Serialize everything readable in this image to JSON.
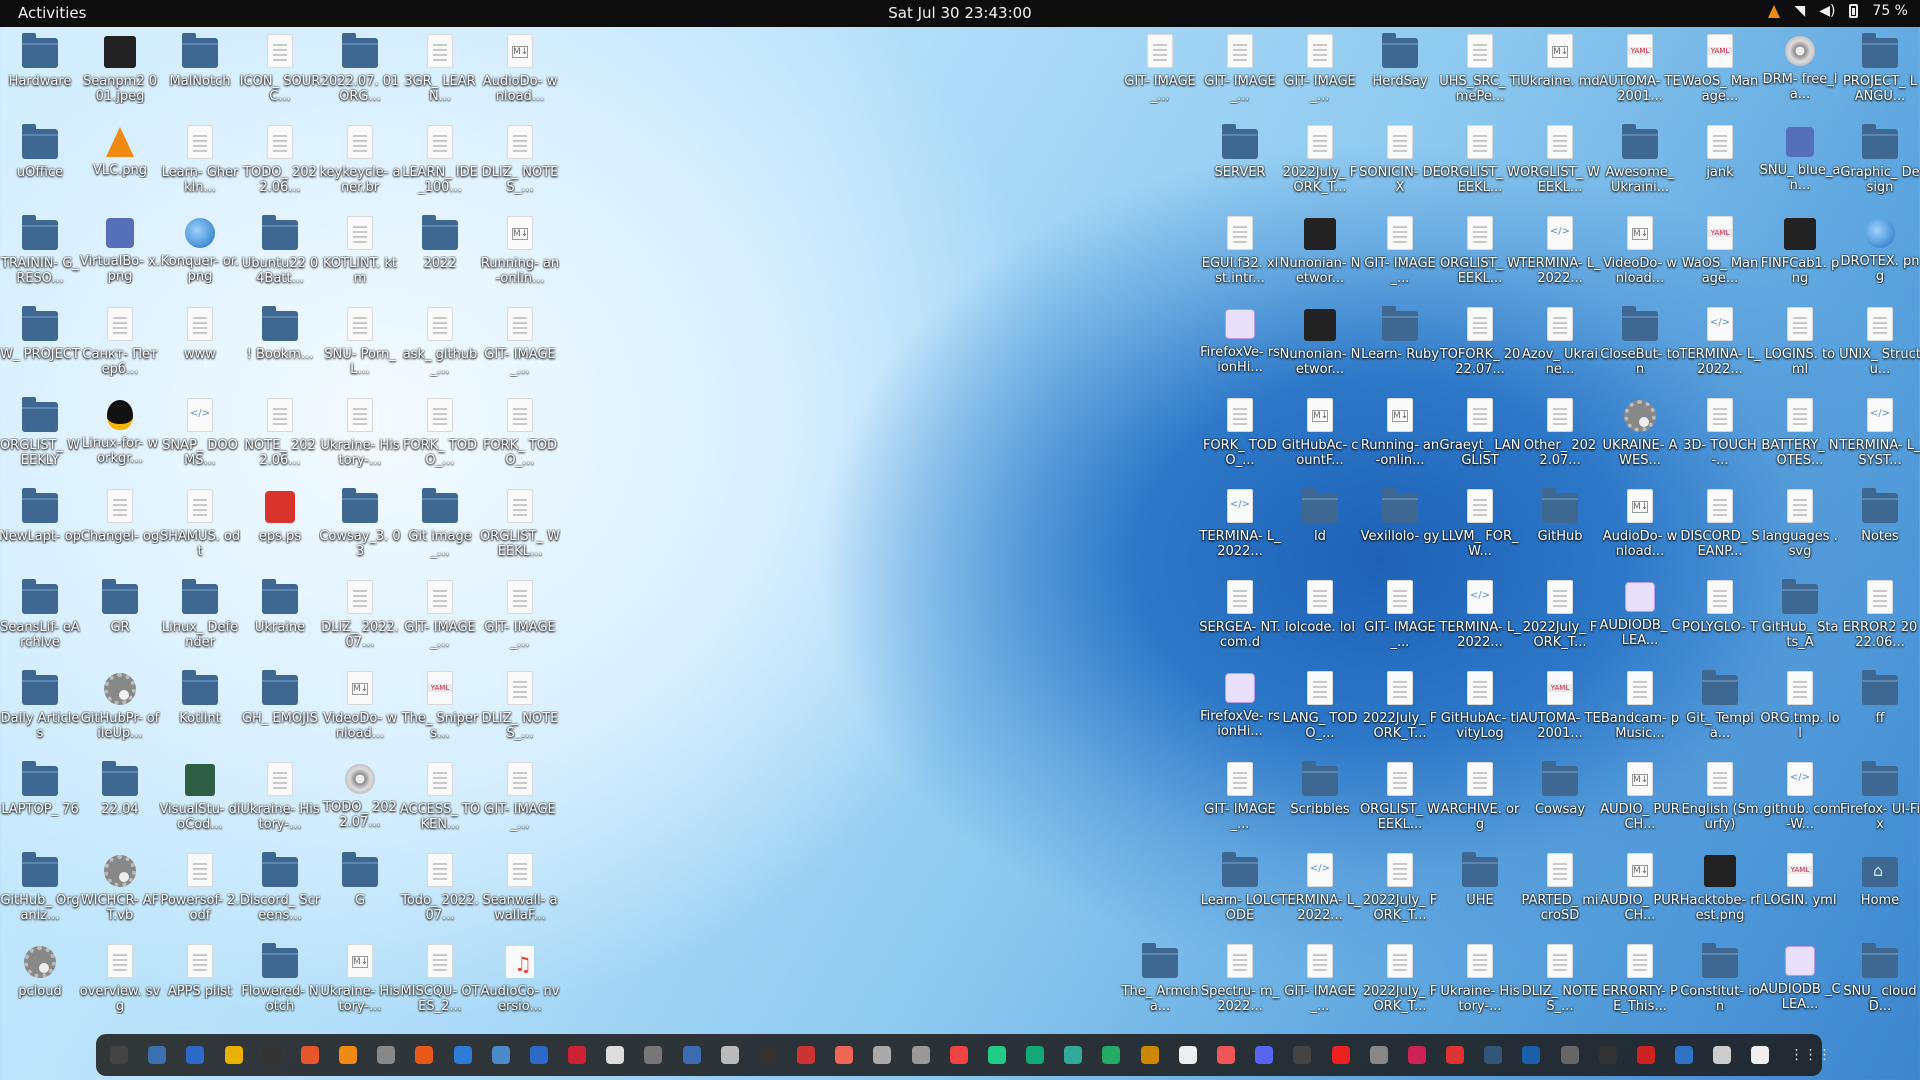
{
  "topbar": {
    "activities": "Activities",
    "clock": "Sat Jul 30  23:43:00",
    "battery": "75 %"
  },
  "desktop": {
    "icons": [
      {
        "label": "Hardware",
        "type": "folder"
      },
      {
        "label": "Seanpm2 001.jpeg",
        "type": "img"
      },
      {
        "label": "MalNotch",
        "type": "folder"
      },
      {
        "label": "ICON_ SOURC...",
        "type": "file"
      },
      {
        "label": "2022.07. 01ORG...",
        "type": "folder"
      },
      {
        "label": "3GR_ LEARN...",
        "type": "file"
      },
      {
        "label": "AudioDo- wnload...",
        "type": "md"
      },
      {
        "label": "uOffice",
        "type": "folder"
      },
      {
        "label": "VLC.png",
        "type": "cone"
      },
      {
        "label": "Learn- Gherkin...",
        "type": "file"
      },
      {
        "label": "TODO_ 2022.06...",
        "type": "file"
      },
      {
        "label": "keykeycle- aner.br",
        "type": "file"
      },
      {
        "label": "LEARN_ IDE_100...",
        "type": "file"
      },
      {
        "label": "DLIZ_ NOTES_...",
        "type": "file"
      },
      {
        "label": "TRAININ- G_RESO...",
        "type": "folder"
      },
      {
        "label": "VirtualBo- x.png",
        "type": "box"
      },
      {
        "label": "Konquer- or.png",
        "type": "globe"
      },
      {
        "label": "Ubuntu22 04Batt...",
        "type": "folder"
      },
      {
        "label": "KOTLINT. ktm",
        "type": "file"
      },
      {
        "label": "2022",
        "type": "folder"
      },
      {
        "label": "Running- an-onlin...",
        "type": "md"
      },
      {
        "label": "W_ PROJECT",
        "type": "folder"
      },
      {
        "label": "Санкт- Петерб...",
        "type": "file"
      },
      {
        "label": "www",
        "type": "file"
      },
      {
        "label": "! Bookm...",
        "type": "folder"
      },
      {
        "label": "SNU- Porn_L...",
        "type": "file"
      },
      {
        "label": "ask_ github_...",
        "type": "file"
      },
      {
        "label": "GIT- IMAGE_...",
        "type": "file"
      },
      {
        "label": "ORGLIST_ WEEKLY",
        "type": "folder"
      },
      {
        "label": "Linux-for- workgr...",
        "type": "penguin"
      },
      {
        "label": "SNAP_ DOOMS...",
        "type": "code"
      },
      {
        "label": "NOTE_ 2022.06...",
        "type": "file"
      },
      {
        "label": "Ukraine- History-...",
        "type": "file"
      },
      {
        "label": "FORK_ TODO_...",
        "type": "file"
      },
      {
        "label": "FORK_ TODO_...",
        "type": "file"
      },
      {
        "label": "NewLapt- op",
        "type": "folder"
      },
      {
        "label": "Changel- og",
        "type": "file"
      },
      {
        "label": "SHAMUS. odt",
        "type": "file"
      },
      {
        "label": "eps.ps",
        "type": "red"
      },
      {
        "label": "Cowsay_3. 03",
        "type": "folder"
      },
      {
        "label": "Git image_...",
        "type": "folder"
      },
      {
        "label": "ORGLIST_ WEEKL...",
        "type": "file"
      },
      {
        "label": "SeansLif- eArchive",
        "type": "folder"
      },
      {
        "label": "GR",
        "type": "folder"
      },
      {
        "label": "Linux_ Defender",
        "type": "folder"
      },
      {
        "label": "Ukraine",
        "type": "folder"
      },
      {
        "label": "DLIZ_ 2022.07...",
        "type": "file"
      },
      {
        "label": "GIT- IMAGE_...",
        "type": "file"
      },
      {
        "label": "GIT- IMAGE_...",
        "type": "file"
      },
      {
        "label": "Daily Articles",
        "type": "folder"
      },
      {
        "label": "GitHubPr- ofileUp...",
        "type": "gear"
      },
      {
        "label": "Kotlint",
        "type": "folder"
      },
      {
        "label": "GH_ EMOJIS",
        "type": "folder"
      },
      {
        "label": "VideoDo- wnload...",
        "type": "md"
      },
      {
        "label": "The_ Snipers...",
        "type": "yaml"
      },
      {
        "label": "DLIZ_ NOTES_...",
        "type": "file"
      },
      {
        "label": "LAPTOP_ 76",
        "type": "folder"
      },
      {
        "label": "22.04",
        "type": "folder"
      },
      {
        "label": "VisualStu- dioCod...",
        "type": "green"
      },
      {
        "label": "Ukraine- History-...",
        "type": "file"
      },
      {
        "label": "TODO_ 2022.07...",
        "type": "disc"
      },
      {
        "label": "ACCESS_ TOKEN...",
        "type": "file"
      },
      {
        "label": "GIT- IMAGE_...",
        "type": "file"
      },
      {
        "label": "GitHub_ Organiz...",
        "type": "folder"
      },
      {
        "label": "WICHCR- AFT.vb",
        "type": "gear"
      },
      {
        "label": "Powersof- 2.odf",
        "type": "file"
      },
      {
        "label": "Discord_ Screens...",
        "type": "folder"
      },
      {
        "label": "G",
        "type": "folder"
      },
      {
        "label": "Todo_ 2022.07...",
        "type": "file"
      },
      {
        "label": "Seanwall- awallaF...",
        "type": "file"
      },
      {
        "label": "pcloud",
        "type": "gear"
      },
      {
        "label": "overview. svg",
        "type": "file"
      },
      {
        "label": "APPS plist",
        "type": "file"
      },
      {
        "label": "Flowered- Notch",
        "type": "folder"
      },
      {
        "label": "Ukraine- History-...",
        "type": "md"
      },
      {
        "label": "MISCQU- OTES_2...",
        "type": "file"
      },
      {
        "label": "AudioCo- nversio...",
        "type": "music"
      }
    ],
    "right_icons": [
      [
        {
          "label": "GIT- IMAGE_...",
          "type": "file"
        },
        {
          "label": "GIT- IMAGE_...",
          "type": "file"
        },
        {
          "label": "GIT- IMAGE_...",
          "type": "file"
        },
        {
          "label": "HerdSay",
          "type": "folder"
        },
        {
          "label": "UHS_SRC_ TimePe...",
          "type": "file"
        },
        {
          "label": "Ukraine. md",
          "type": "md"
        },
        {
          "label": "AUTOMA- TE2001...",
          "type": "yaml"
        },
        {
          "label": "WaOS_ Manage...",
          "type": "yaml"
        },
        {
          "label": "DRM- free_la...",
          "type": "disc"
        },
        {
          "label": "PROJECT_ LANGU...",
          "type": "folder"
        }
      ],
      [
        {
          "label": "SERVER",
          "type": "folder"
        },
        {
          "label": "2022July_ FORK_T...",
          "type": "file"
        },
        {
          "label": "SONICIN- DEX",
          "type": "file"
        },
        {
          "label": "ORGLIST_ WEEKL...",
          "type": "file"
        },
        {
          "label": "ORGLIST_ WEEKL...",
          "type": "file"
        },
        {
          "label": "Awesome_ Ukraini...",
          "type": "folder"
        },
        {
          "label": "jank",
          "type": "file"
        },
        {
          "label": "SNU_ blue_an...",
          "type": "box"
        },
        {
          "label": "Graphic_ Design",
          "type": "folder"
        }
      ],
      [
        {
          "label": "EGUI.f32. xlst.intr...",
          "type": "file"
        },
        {
          "label": "Nunonian- Networ...",
          "type": "img"
        },
        {
          "label": "GIT- IMAGE_...",
          "type": "file"
        },
        {
          "label": "ORGLIST_ WEEKL...",
          "type": "file"
        },
        {
          "label": "TERMINA- L_2022...",
          "type": "code"
        },
        {
          "label": "VideoDo- wnload...",
          "type": "md"
        },
        {
          "label": "WaOS_ Manage...",
          "type": "yaml"
        },
        {
          "label": "FINFCab1. png",
          "type": "img"
        },
        {
          "label": "DROTEX. png",
          "type": "globe"
        }
      ],
      [
        {
          "label": "FirefoxVe- rsionHi...",
          "type": "purple"
        },
        {
          "label": "Nunonian- Networ...",
          "type": "img"
        },
        {
          "label": "Learn- Ruby",
          "type": "folder"
        },
        {
          "label": "TOFORK_ 2022.07...",
          "type": "file"
        },
        {
          "label": "Azov_ Ukraine...",
          "type": "file"
        },
        {
          "label": "CloseBut- ton",
          "type": "folder"
        },
        {
          "label": "TERMINA- L_2022...",
          "type": "code"
        },
        {
          "label": "LOGINS. toml",
          "type": "file"
        },
        {
          "label": "UNIX_ Structu...",
          "type": "file"
        }
      ],
      [
        {
          "label": "FORK_ TODO_...",
          "type": "file"
        },
        {
          "label": "GitHubAc- countF...",
          "type": "md"
        },
        {
          "label": "Running- an-onlin...",
          "type": "md"
        },
        {
          "label": "Graeyt_ LANGLIST",
          "type": "file"
        },
        {
          "label": "Other_ 2022.07...",
          "type": "file"
        },
        {
          "label": "UKRAINE- AWES...",
          "type": "gear"
        },
        {
          "label": "3D- TOUCH-...",
          "type": "file"
        },
        {
          "label": "BATTERY_ NOTES...",
          "type": "file"
        },
        {
          "label": "TERMINA- L_SYST...",
          "type": "code"
        }
      ],
      [
        {
          "label": "TERMINA- L_2022...",
          "type": "code"
        },
        {
          "label": "ld",
          "type": "folder"
        },
        {
          "label": "Vexillolo- gy",
          "type": "folder"
        },
        {
          "label": "LLVM_ FOR_W...",
          "type": "file"
        },
        {
          "label": "GitHub",
          "type": "folder"
        },
        {
          "label": "AudioDo- wnload...",
          "type": "md"
        },
        {
          "label": "DISCORD_ SEANP...",
          "type": "file"
        },
        {
          "label": "languages .svg",
          "type": "file"
        },
        {
          "label": "Notes",
          "type": "folder"
        }
      ],
      [
        {
          "label": "SERGEA- NT.com.d",
          "type": "file"
        },
        {
          "label": "lolcode. lol",
          "type": "file"
        },
        {
          "label": "GIT- IMAGE_...",
          "type": "file"
        },
        {
          "label": "TERMINA- L_2022...",
          "type": "code"
        },
        {
          "label": "2022July_ FORK_T...",
          "type": "file"
        },
        {
          "label": "AUDIODB_ CLEA...",
          "type": "purple"
        },
        {
          "label": "POLYGLO- T",
          "type": "file"
        },
        {
          "label": "GitHub_ Stats_A",
          "type": "folder"
        },
        {
          "label": "ERROR2 2022.06...",
          "type": "file"
        }
      ],
      [
        {
          "label": "FirefoxVe- rsionHi...",
          "type": "purple"
        },
        {
          "label": "LANG_ TODO_...",
          "type": "file"
        },
        {
          "label": "2022July_ FORK_T...",
          "type": "file"
        },
        {
          "label": "GitHubAc- tivityLog",
          "type": "file"
        },
        {
          "label": "AUTOMA- TE2001...",
          "type": "yaml"
        },
        {
          "label": "Bandcam- pMusic...",
          "type": "file"
        },
        {
          "label": "Git_ Templa...",
          "type": "folder"
        },
        {
          "label": "ORG.tmp. lol",
          "type": "file"
        },
        {
          "label": "ff",
          "type": "folder"
        }
      ],
      [
        {
          "label": "GIT- IMAGE_...",
          "type": "file"
        },
        {
          "label": "Scribbles",
          "type": "folder"
        },
        {
          "label": "ORGLIST_ WEEKL...",
          "type": "file"
        },
        {
          "label": "ARCHIVE. org",
          "type": "file"
        },
        {
          "label": "Cowsay",
          "type": "folder"
        },
        {
          "label": "AUDIO_ PURCH...",
          "type": "md"
        },
        {
          "label": "English (Smurfy)",
          "type": "file"
        },
        {
          "label": ".github. com-W...",
          "type": "code"
        },
        {
          "label": "Firefox- UI-Fix",
          "type": "folder"
        }
      ],
      [
        {
          "label": "Learn- LOLCODE",
          "type": "folder"
        },
        {
          "label": "TERMINA- L_2022...",
          "type": "code"
        },
        {
          "label": "2022July_ FORK_T...",
          "type": "file"
        },
        {
          "label": "UHE",
          "type": "folder"
        },
        {
          "label": "PARTED_ microSD",
          "type": "file"
        },
        {
          "label": "AUDIO_ PURCH...",
          "type": "md"
        },
        {
          "label": "Hacktobe- rfest.png",
          "type": "img"
        },
        {
          "label": "LOGIN. yml",
          "type": "yaml"
        },
        {
          "label": "Home",
          "type": "home"
        }
      ],
      [
        {
          "label": "The_ Armcha...",
          "type": "folder"
        },
        {
          "label": "Spectru- m_2022...",
          "type": "file"
        },
        {
          "label": "GIT- IMAGE_...",
          "type": "file"
        },
        {
          "label": "2022July_ FORK_T...",
          "type": "file"
        },
        {
          "label": "Ukraine- History-...",
          "type": "file"
        },
        {
          "label": "DLIZ_ NOTES_...",
          "type": "file"
        },
        {
          "label": "ERRORTY- PE_This...",
          "type": "file"
        },
        {
          "label": "Constitut- ion",
          "type": "folder"
        },
        {
          "label": "AUDIODB _CLEA...",
          "type": "purple"
        },
        {
          "label": "SNU_ cloudD...",
          "type": "folder"
        }
      ]
    ]
  },
  "dock": {
    "apps": [
      "terminal",
      "files",
      "editor",
      "notes",
      "console",
      "firefox",
      "vlc",
      "obs",
      "software",
      "writer",
      "calendar",
      "help",
      "monitor",
      "text",
      "gimp",
      "virtualbox",
      "circle",
      "inkscape",
      "game",
      "player",
      "archive",
      "viewer",
      "chrome",
      "photos",
      "settings",
      "camera",
      "spreadsheet",
      "mail",
      "backups",
      "impress",
      "discord",
      "steam",
      "image",
      "calc",
      "tv",
      "vm",
      "ide",
      "terminal2",
      "window",
      "github",
      "store",
      "dashboard",
      "wallpaper",
      "clock",
      "apps-grid"
    ]
  }
}
